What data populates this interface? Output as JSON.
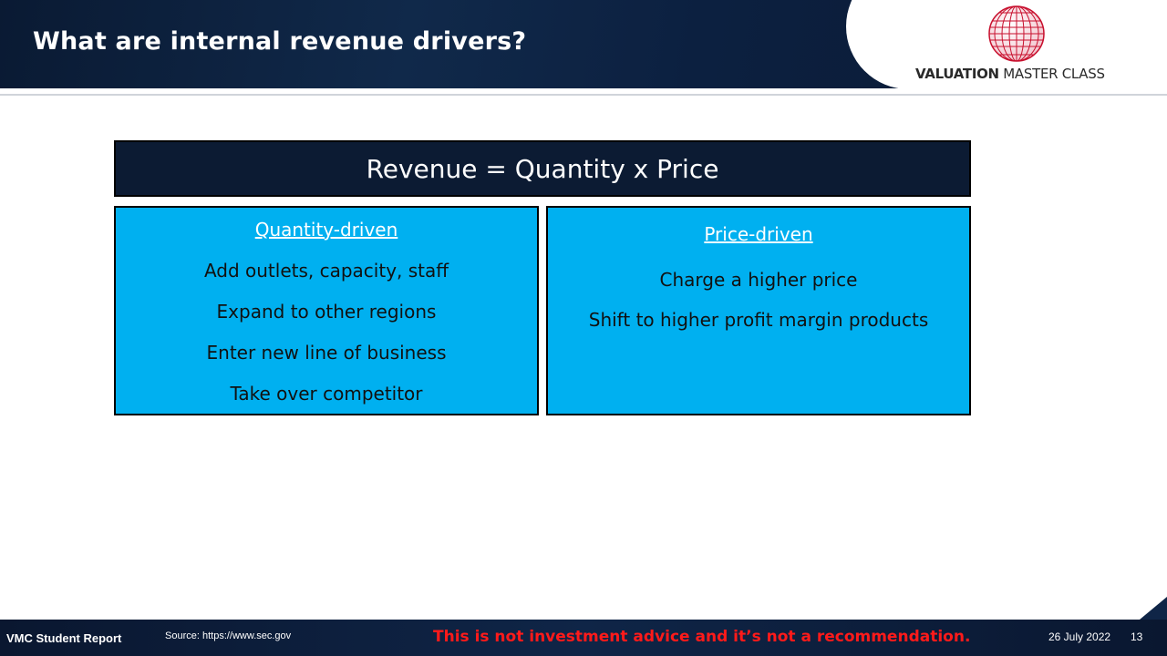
{
  "header": {
    "title": "What are internal revenue drivers?",
    "logo_icon": "globe-icon",
    "logo_text_bold": "VALUATION",
    "logo_text_rest": " MASTER CLASS"
  },
  "formula": "Revenue = Quantity x Price",
  "quantity_box": {
    "title": "Quantity-driven",
    "items": [
      "Add outlets, capacity, staff",
      "Expand to other regions",
      "Enter new line of business",
      "Take over competitor"
    ]
  },
  "price_box": {
    "title": "Price-driven",
    "items": [
      "Charge a higher price",
      "Shift to higher profit margin products"
    ]
  },
  "footer": {
    "report": "VMC Student Report",
    "source": "Source: https://www.sec.gov",
    "disclaimer": "This is not investment advice and it’s not a recommendation.",
    "date": "26 July 2022",
    "page": "13"
  },
  "colors": {
    "navy": "#0c1b33",
    "cyan": "#00b0f0",
    "disclaimer_red": "#ff1a1a",
    "logo_red": "#c8102e"
  }
}
